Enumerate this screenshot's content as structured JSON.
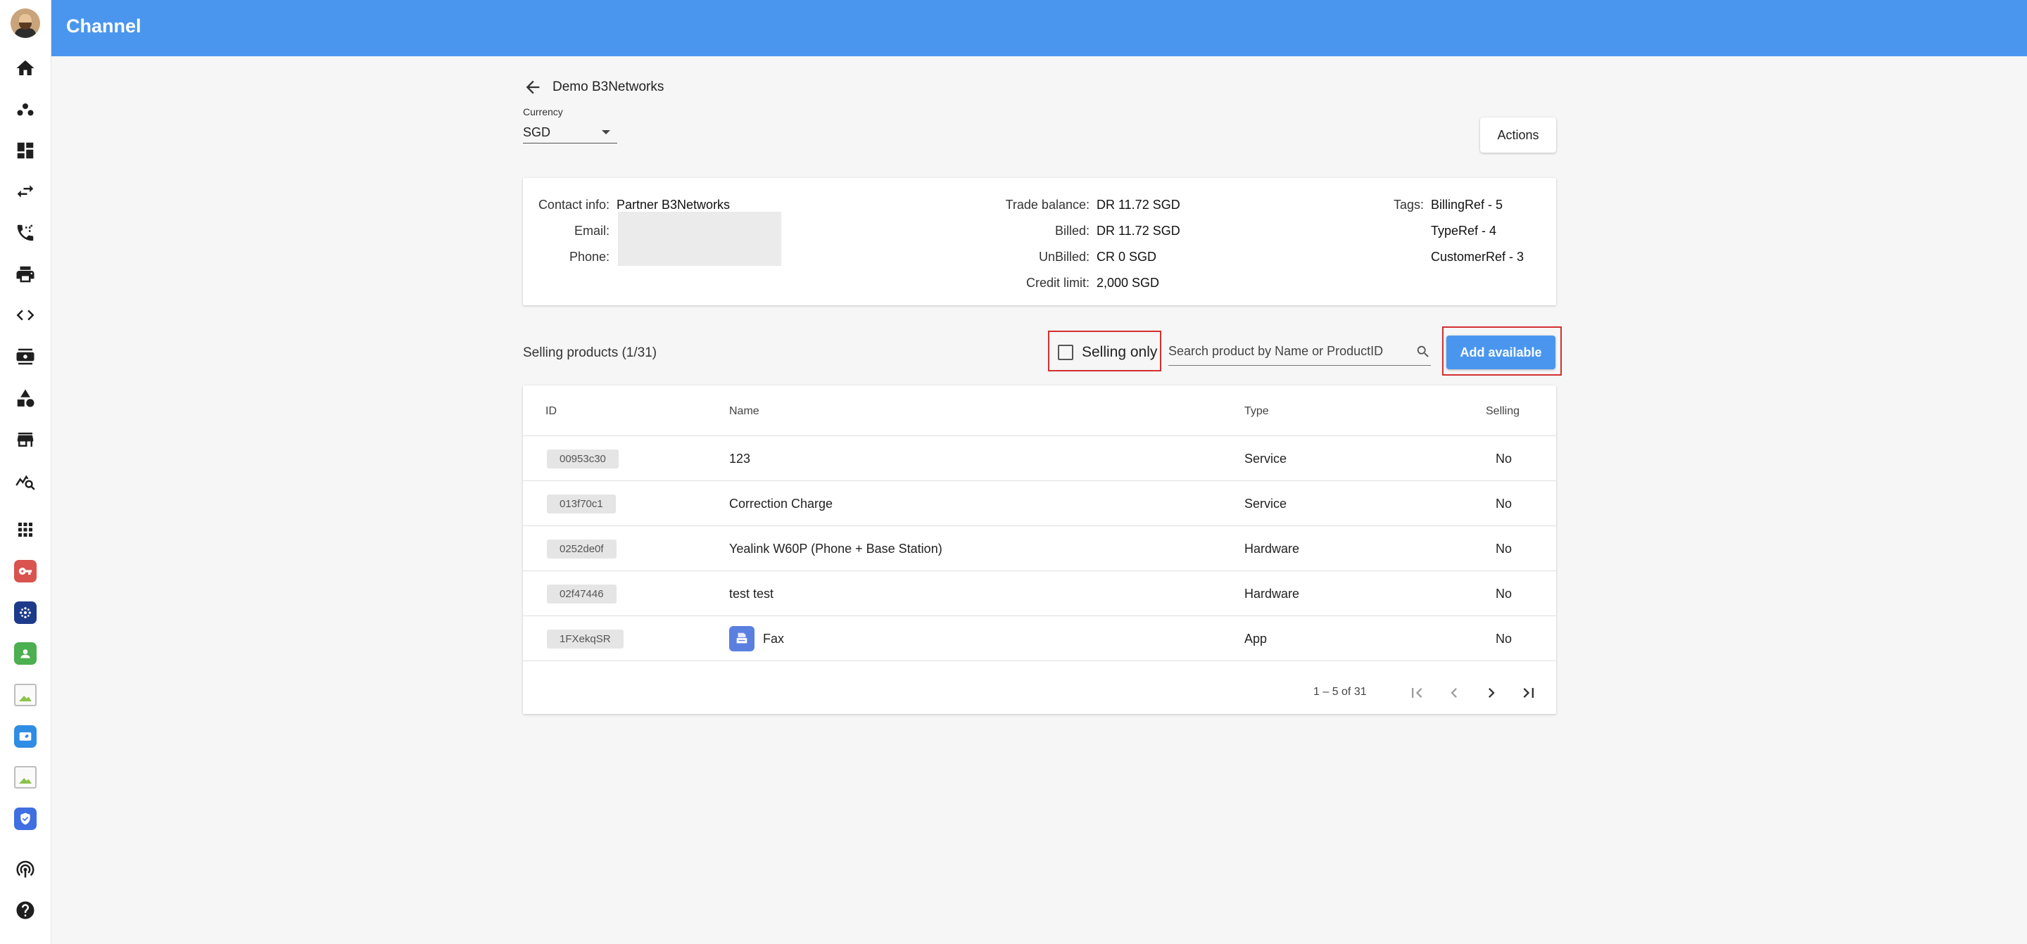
{
  "header": {
    "title": "Channel"
  },
  "sidebar": {
    "nav_icons": [
      "home-icon",
      "groups-icon",
      "dashboard-icon",
      "swap-icon",
      "phone-forward-icon",
      "print-icon",
      "code-icon",
      "contact-card-icon",
      "shapes-icon",
      "store-icon",
      "query-stats-icon"
    ],
    "apps": [
      {
        "icon": "grid-apps-icon"
      },
      {
        "icon": "key-app-icon",
        "color": "#d9534f"
      },
      {
        "icon": "hub-app-icon",
        "color": "#1e3a8a"
      },
      {
        "icon": "support-app-icon",
        "color": "#4caf50"
      },
      {
        "icon": "broken-image-icon"
      },
      {
        "icon": "card-app-icon",
        "color": "#2f8de4"
      },
      {
        "icon": "broken-image-icon"
      },
      {
        "icon": "shield-app-icon",
        "color": "#3f6fe0"
      }
    ],
    "bottom_icons": [
      "podcast-icon",
      "help-icon"
    ]
  },
  "page": {
    "title": "Demo B3Networks",
    "currency": {
      "label": "Currency",
      "value": "SGD"
    },
    "actions_label": "Actions"
  },
  "contact": {
    "contact_info_label": "Contact info:",
    "contact_info": "Partner B3Networks",
    "email_label": "Email:",
    "phone_label": "Phone:"
  },
  "balance": {
    "trade_balance_label": "Trade balance:",
    "trade_balance": "DR 11.72 SGD",
    "billed_label": "Billed:",
    "billed": "DR 11.72 SGD",
    "unbilled_label": "UnBilled:",
    "unbilled": "CR 0 SGD",
    "credit_limit_label": "Credit limit:",
    "credit_limit": "2,000 SGD"
  },
  "tags": {
    "label": "Tags:",
    "values": [
      "BillingRef - 5",
      "TypeRef - 4",
      "CustomerRef - 3"
    ]
  },
  "products": {
    "title": "Selling products (1/31)",
    "selling_only_label": "Selling only",
    "selling_only_checked": false,
    "search_placeholder": "Search product by Name or ProductID",
    "add_label": "Add available",
    "columns": [
      "ID",
      "Name",
      "Type",
      "Selling"
    ],
    "rows": [
      {
        "id": "00953c30",
        "name": "123",
        "type": "Service",
        "selling": "No"
      },
      {
        "id": "013f70c1",
        "name": "Correction Charge",
        "type": "Service",
        "selling": "No"
      },
      {
        "id": "0252de0f",
        "name": "Yealink W60P (Phone + Base Station)",
        "type": "Hardware",
        "selling": "No"
      },
      {
        "id": "02f47446",
        "name": "test test",
        "type": "Hardware",
        "selling": "No"
      },
      {
        "id": "1FXekqSR",
        "name": "Fax",
        "type": "App",
        "selling": "No",
        "icon": "fax-app-icon"
      }
    ],
    "range_label": "1 – 5 of 31"
  },
  "colors": {
    "primary": "#4a96ee",
    "highlight": "#d32f2f"
  }
}
